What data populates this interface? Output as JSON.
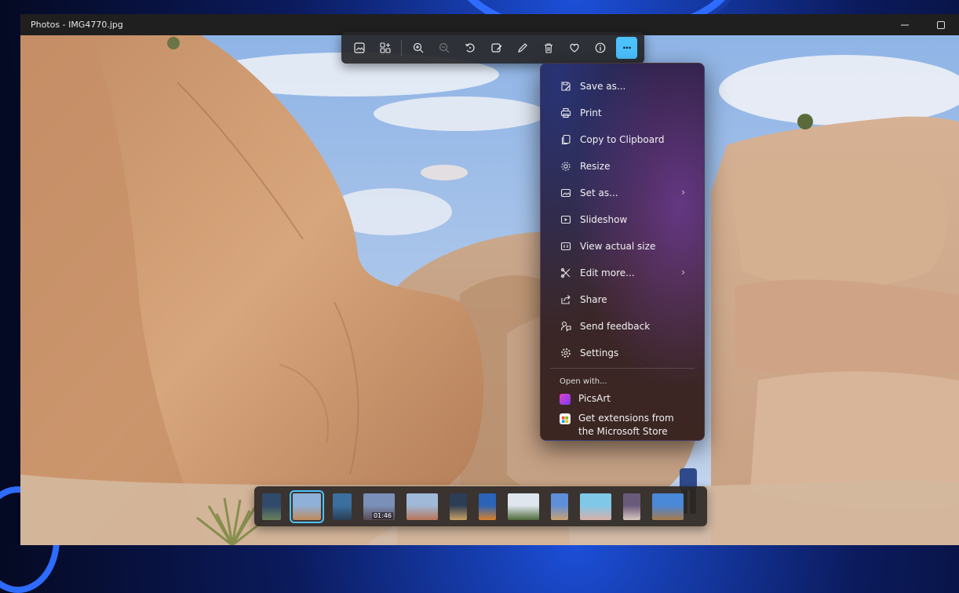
{
  "window": {
    "title": "Photos - IMG4770.jpg",
    "controls": [
      "minimize-icon",
      "maximize-icon"
    ]
  },
  "toolbar": {
    "buttons": [
      {
        "icon": "image-icon",
        "label": "View"
      },
      {
        "icon": "grid-add-icon",
        "label": "Add"
      },
      {
        "icon": "zoom-in-icon",
        "label": "Zoom in"
      },
      {
        "icon": "zoom-out-icon",
        "label": "Zoom out",
        "disabled": true
      },
      {
        "icon": "rotate-icon",
        "label": "Rotate"
      },
      {
        "icon": "edit-image-icon",
        "label": "Edit image"
      },
      {
        "icon": "pen-icon",
        "label": "Draw"
      },
      {
        "icon": "trash-icon",
        "label": "Delete"
      },
      {
        "icon": "heart-icon",
        "label": "Favorite"
      },
      {
        "icon": "info-icon",
        "label": "File information"
      },
      {
        "icon": "more-icon",
        "label": "···",
        "active": true
      }
    ]
  },
  "menu": {
    "items": [
      {
        "icon": "save-as-icon",
        "label": "Save as..."
      },
      {
        "icon": "print-icon",
        "label": "Print"
      },
      {
        "icon": "copy-icon",
        "label": "Copy to Clipboard"
      },
      {
        "icon": "resize-icon",
        "label": "Resize"
      },
      {
        "icon": "set-as-icon",
        "label": "Set as...",
        "submenu": true
      },
      {
        "icon": "slideshow-icon",
        "label": "Slideshow"
      },
      {
        "icon": "actual-size-icon",
        "label": "View actual size"
      },
      {
        "icon": "edit-more-icon",
        "label": "Edit more...",
        "submenu": true
      },
      {
        "icon": "share-icon",
        "label": "Share"
      },
      {
        "icon": "feedback-icon",
        "label": "Send feedback"
      },
      {
        "icon": "settings-icon",
        "label": "Settings"
      }
    ],
    "open_with_label": "Open with...",
    "apps": [
      {
        "icon": "picsart-icon",
        "label": "PicsArt",
        "color": "#c23bd8"
      },
      {
        "icon": "store-icon",
        "label": "Get extensions from the Microsoft Store",
        "color": "#f3f3f3"
      }
    ]
  },
  "filmstrip": {
    "selected_index": 1,
    "thumbnails": [
      {
        "colors": [
          "#2f4a6a",
          "#6a7f5a"
        ]
      },
      {
        "colors": [
          "#8fb0d8",
          "#c08a5a"
        ]
      },
      {
        "colors": [
          "#3b6f9e",
          "#2a3e55"
        ]
      },
      {
        "colors": [
          "#7a90b8",
          "#5a4a52"
        ],
        "duration": "01:46"
      },
      {
        "colors": [
          "#a0b9d8",
          "#b87458"
        ]
      },
      {
        "colors": [
          "#2c3d56",
          "#c9a062"
        ]
      },
      {
        "colors": [
          "#2a63b8",
          "#d8822a"
        ]
      },
      {
        "colors": [
          "#dfe6ee",
          "#4e6a3a"
        ]
      },
      {
        "colors": [
          "#5f8fd8",
          "#caa070"
        ]
      },
      {
        "colors": [
          "#7fc8e8",
          "#d8b0a8"
        ]
      },
      {
        "colors": [
          "#6a5a7a",
          "#d8c8c0"
        ]
      },
      {
        "colors": [
          "#4a88d8",
          "#a87a4a"
        ]
      }
    ]
  },
  "colors": {
    "accent": "#4cc2ff",
    "window_bg": "#202020"
  }
}
